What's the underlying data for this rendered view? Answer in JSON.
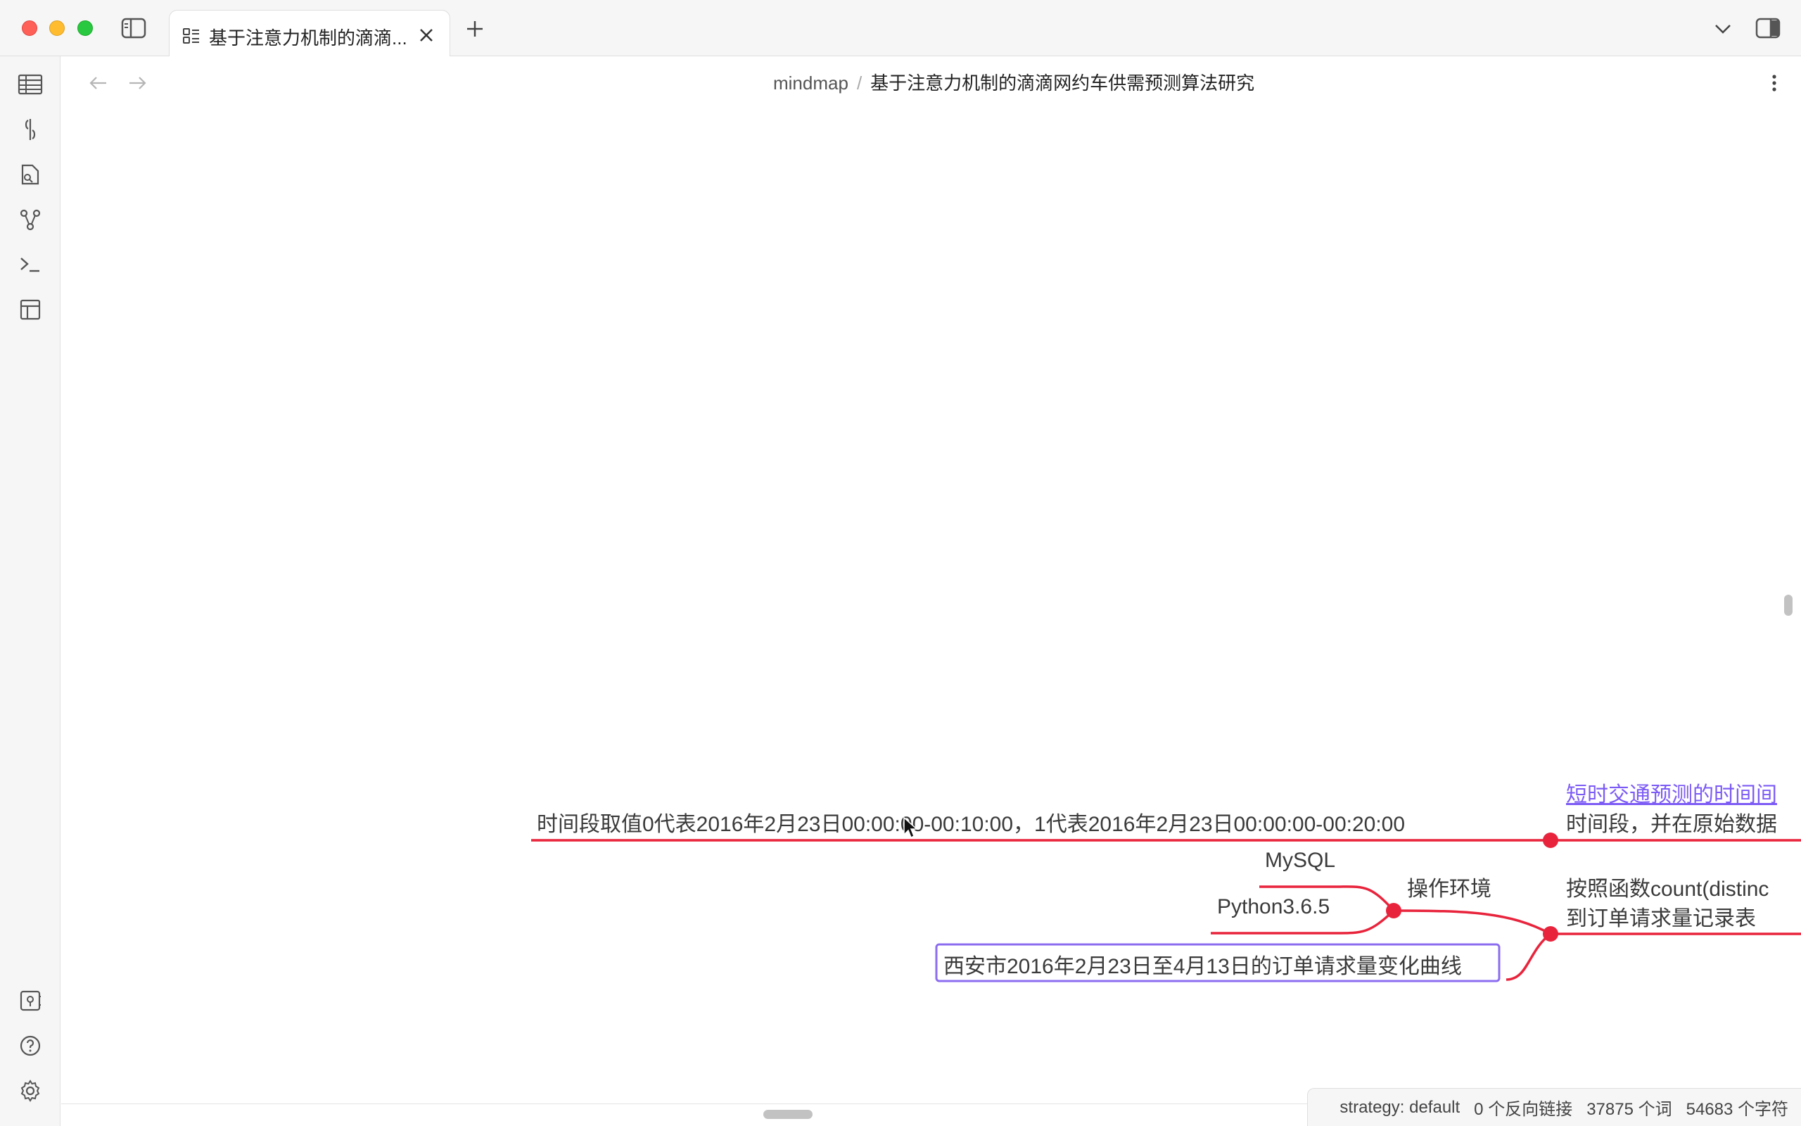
{
  "window": {
    "tab_title": "基于注意力机制的滴滴...",
    "icons": [
      "sidebar-toggle-icon",
      "note-icon",
      "close-icon",
      "plus-icon",
      "chevron-down-icon",
      "right-sidebar-icon"
    ]
  },
  "header": {
    "breadcrumb_root": "mindmap",
    "breadcrumb_sep": "/",
    "breadcrumb_title": "基于注意力机制的滴滴网约车供需预测算法研究"
  },
  "ribbon": {
    "top_icons": [
      "table-icon",
      "link-icon",
      "file-search-icon",
      "graph-icon",
      "terminal-icon",
      "layout-icon"
    ],
    "bottom_icons": [
      "vault-icon",
      "help-icon",
      "settings-icon"
    ]
  },
  "mindmap": {
    "timeslot_note": "时间段取值0代表2016年2月23日00:00:00-00:10:00，1代表2016年2月23日00:00:00-00:20:00",
    "link_node": "短时交通预测的时间间",
    "timeslot_node": "时间段，并在原始数据",
    "env_label": "操作环境",
    "env_mysql": "MySQL",
    "env_python": "Python3.6.5",
    "count_node_line1": "按照函数count(distinc",
    "count_node_line2": "到订单请求量记录表",
    "curve_node": "西安市2016年2月23日至4月13日的订单请求量变化曲线",
    "colors": {
      "branch": "#e8243c",
      "selected": "#8b6cf0",
      "link": "#7c5bf5"
    }
  },
  "status": {
    "strategy": "strategy: default",
    "backlinks": "0 个反向链接",
    "words": "37875 个词",
    "chars": "54683 个字符"
  }
}
